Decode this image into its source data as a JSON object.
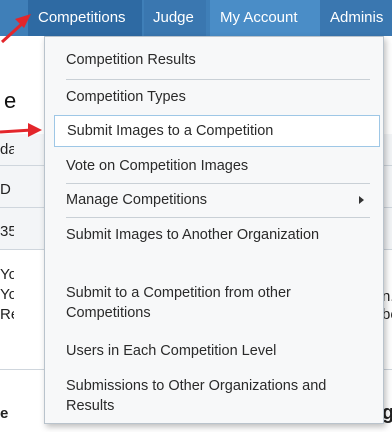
{
  "navbar": {
    "items": [
      "Competitions",
      "Judge",
      "My Account",
      "Adminis"
    ]
  },
  "background": {
    "left_fragments": [
      "da",
      "D",
      "35",
      "Yo",
      "Yo",
      "Re",
      "e"
    ],
    "right_fragments": [
      "n.",
      "be",
      "ge"
    ]
  },
  "annotation": {
    "partial_word": "e"
  },
  "menu": {
    "items": [
      {
        "label": "Competition Results"
      },
      {
        "label": "Competition Types"
      },
      {
        "label": "Submit Images to a Competition",
        "active": true
      },
      {
        "label": "Vote on Competition Images"
      },
      {
        "label": "Manage Competitions",
        "has_submenu": true
      },
      {
        "label": "Submit Images to Another Organization"
      },
      {
        "label": "Submit to a Competition from other Competitions"
      },
      {
        "label": "Users in Each Competition Level"
      },
      {
        "label": "Submissions to Other Organizations and Results"
      }
    ]
  },
  "colors": {
    "navbar": "#3f7fb8",
    "menu_bg": "#f7f8f9",
    "highlight_border": "#9ec7e6",
    "arrow": "#e3262b"
  },
  "icons": [
    "submenu-arrow-icon",
    "annotation-arrow-icon"
  ]
}
